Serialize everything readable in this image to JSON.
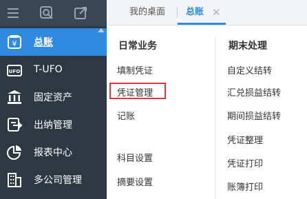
{
  "toolbar": {
    "icons": [
      "menu-icon",
      "search-icon",
      "export-icon"
    ]
  },
  "sidebar": {
    "items": [
      {
        "label": "总账",
        "icon": "ledger-icon",
        "active": true
      },
      {
        "label": "T-UFO",
        "icon": "ufo-icon"
      },
      {
        "label": "固定资产",
        "icon": "bank-icon"
      },
      {
        "label": "出纳管理",
        "icon": "cashier-icon"
      },
      {
        "label": "报表中心",
        "icon": "pie-chart-icon"
      },
      {
        "label": "多公司管理",
        "icon": "building-icon"
      }
    ]
  },
  "tabs": {
    "home": "我的桌面",
    "current": "总账",
    "close": "✕"
  },
  "menu": {
    "daily": {
      "title": "日常业务",
      "items": [
        "填制凭证",
        "凭证管理",
        "记账",
        "科目设置",
        "摘要设置"
      ]
    },
    "period_end": {
      "title": "期末处理",
      "items": [
        "自定义结转",
        "汇兑损益结转",
        "期间损益结转",
        "凭证整理",
        "凭证打印",
        "账簿打印"
      ]
    }
  },
  "colors": {
    "sidebar_bg": "#2d3843",
    "active_bg": "#2f8ae0",
    "highlight": "#e0363b"
  }
}
